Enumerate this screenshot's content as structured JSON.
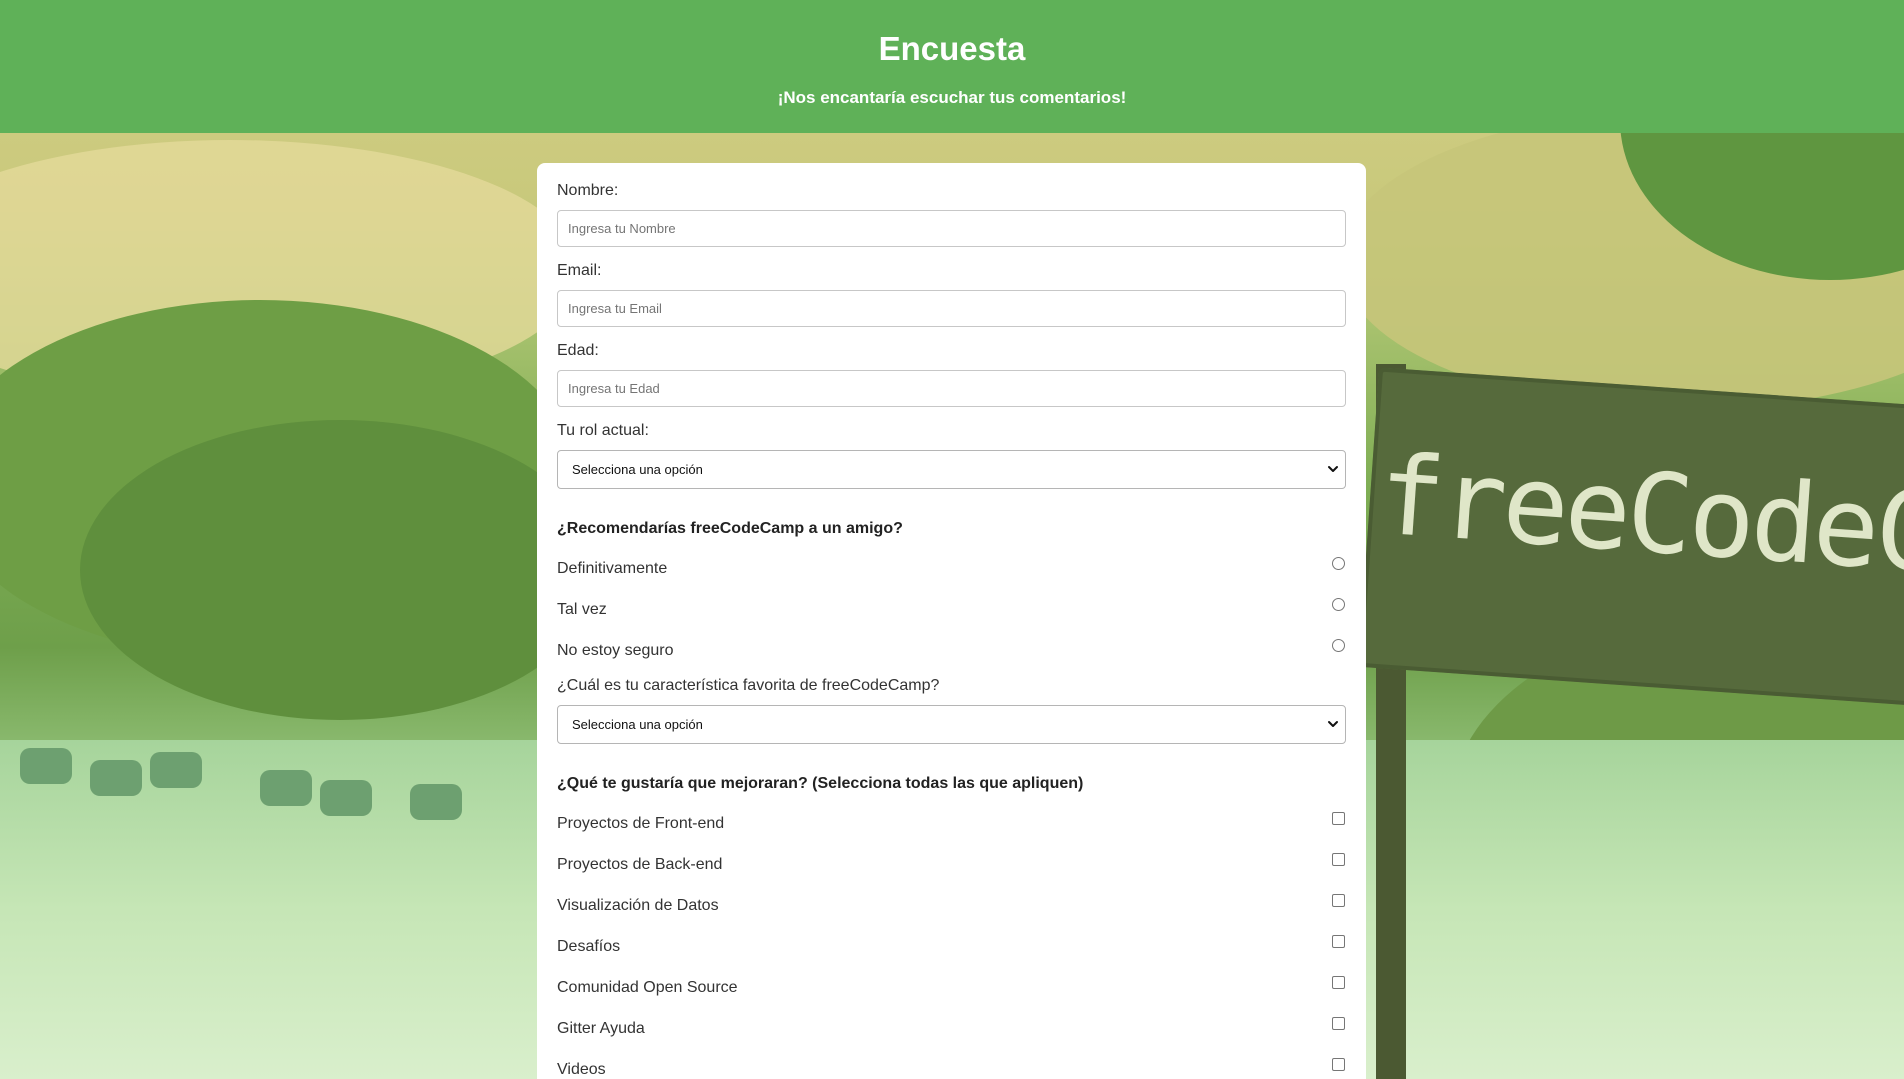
{
  "header": {
    "title": "Encuesta",
    "description": "¡Nos encantaría escuchar tus comentarios!"
  },
  "background": {
    "sign_text": "freeCodeCa"
  },
  "form": {
    "name": {
      "label": "Nombre:",
      "placeholder": "Ingresa tu Nombre"
    },
    "email": {
      "label": "Email:",
      "placeholder": "Ingresa tu Email"
    },
    "age": {
      "label": "Edad:",
      "placeholder": "Ingresa tu Edad"
    },
    "role": {
      "label": "Tu rol actual:",
      "selected": "Selecciona una opción"
    },
    "recommend": {
      "question": "¿Recomendarías freeCodeCamp a un amigo?",
      "options": [
        "Definitivamente",
        "Tal vez",
        "No estoy seguro"
      ]
    },
    "favorite": {
      "label": "¿Cuál es tu característica favorita de freeCodeCamp?",
      "selected": "Selecciona una opción"
    },
    "improve": {
      "question": "¿Qué te gustaría que mejoraran? (Selecciona todas las que apliquen)",
      "options": [
        "Proyectos de Front-end",
        "Proyectos de Back-end",
        "Visualización de Datos",
        "Desafíos",
        "Comunidad Open Source",
        "Gitter Ayuda",
        "Videos"
      ]
    }
  },
  "colors": {
    "header_bg": "#5fb158",
    "card_bg": "#ffffff"
  }
}
